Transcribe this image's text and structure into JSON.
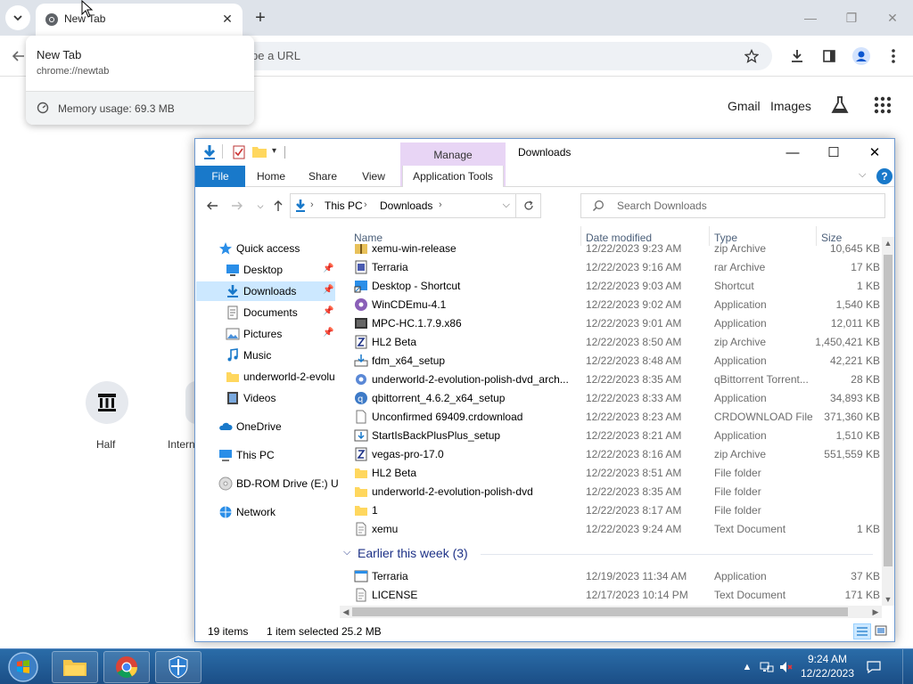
{
  "chrome": {
    "tab_title": "New Tab",
    "omnibox_text": "pe a URL",
    "ntp_links": [
      "Gmail",
      "Images"
    ],
    "shortcuts": [
      "Half",
      "Intern"
    ],
    "hover_card": {
      "title": "New Tab",
      "url": "chrome://newtab",
      "memory": "Memory usage: 69.3 MB"
    }
  },
  "explorer": {
    "title": "Downloads",
    "context_tab": "Manage",
    "ribbon_tabs": [
      "File",
      "Home",
      "Share",
      "View",
      "Application Tools"
    ],
    "breadcrumb": [
      "This PC",
      "Downloads"
    ],
    "search_placeholder": "Search Downloads",
    "nav": [
      {
        "label": "Quick access",
        "icon": "star-icon",
        "pinned": false
      },
      {
        "label": "Desktop",
        "icon": "desktop-icon",
        "pinned": true
      },
      {
        "label": "Downloads",
        "icon": "download-arrow-icon",
        "pinned": true,
        "selected": true
      },
      {
        "label": "Documents",
        "icon": "documents-icon",
        "pinned": true
      },
      {
        "label": "Pictures",
        "icon": "pictures-icon",
        "pinned": true
      },
      {
        "label": "Music",
        "icon": "music-note-icon",
        "pinned": false
      },
      {
        "label": "underworld-2-evolu",
        "icon": "folder-icon",
        "pinned": false
      },
      {
        "label": "Videos",
        "icon": "film-icon",
        "pinned": false
      },
      {
        "label": "OneDrive",
        "icon": "cloud-icon",
        "pinned": false
      },
      {
        "label": "This PC",
        "icon": "computer-icon",
        "pinned": false
      },
      {
        "label": "BD-ROM Drive (E:) UI",
        "icon": "disc-icon",
        "pinned": false
      },
      {
        "label": "Network",
        "icon": "network-icon",
        "pinned": false
      }
    ],
    "columns": [
      "Name",
      "Date modified",
      "Type",
      "Size"
    ],
    "files": [
      {
        "name": "xemu-win-release",
        "date": "12/22/2023 9:23 AM",
        "type": "zip Archive",
        "size": "10,645 KB",
        "icon": "zip-icon"
      },
      {
        "name": "Terraria",
        "date": "12/22/2023 9:16 AM",
        "type": "rar Archive",
        "size": "17 KB",
        "icon": "rar-icon"
      },
      {
        "name": "Desktop - Shortcut",
        "date": "12/22/2023 9:03 AM",
        "type": "Shortcut",
        "size": "1 KB",
        "icon": "shortcut-icon"
      },
      {
        "name": "WinCDEmu-4.1",
        "date": "12/22/2023 9:02 AM",
        "type": "Application",
        "size": "1,540 KB",
        "icon": "app-icon"
      },
      {
        "name": "MPC-HC.1.7.9.x86",
        "date": "12/22/2023 9:01 AM",
        "type": "Application",
        "size": "12,011 KB",
        "icon": "app-icon"
      },
      {
        "name": "HL2 Beta",
        "date": "12/22/2023 8:50 AM",
        "type": "zip Archive",
        "size": "1,450,421 KB",
        "icon": "zip-icon"
      },
      {
        "name": "fdm_x64_setup",
        "date": "12/22/2023 8:48 AM",
        "type": "Application",
        "size": "42,221 KB",
        "icon": "installer-icon"
      },
      {
        "name": "underworld-2-evolution-polish-dvd_arch...",
        "date": "12/22/2023 8:35 AM",
        "type": "qBittorrent Torrent...",
        "size": "28 KB",
        "icon": "torrent-icon"
      },
      {
        "name": "qbittorrent_4.6.2_x64_setup",
        "date": "12/22/2023 8:33 AM",
        "type": "Application",
        "size": "34,893 KB",
        "icon": "qbittorrent-icon"
      },
      {
        "name": "Unconfirmed 69409.crdownload",
        "date": "12/22/2023 8:23 AM",
        "type": "CRDOWNLOAD File",
        "size": "371,360 KB",
        "icon": "blank-file-icon"
      },
      {
        "name": "StartIsBackPlusPlus_setup",
        "date": "12/22/2023 8:21 AM",
        "type": "Application",
        "size": "1,510 KB",
        "icon": "installer-icon"
      },
      {
        "name": "vegas-pro-17.0",
        "date": "12/22/2023 8:16 AM",
        "type": "zip Archive",
        "size": "551,559 KB",
        "icon": "zip-icon"
      },
      {
        "name": "HL2 Beta",
        "date": "12/22/2023 8:51 AM",
        "type": "File folder",
        "size": "",
        "icon": "folder-icon"
      },
      {
        "name": "underworld-2-evolution-polish-dvd",
        "date": "12/22/2023 8:35 AM",
        "type": "File folder",
        "size": "",
        "icon": "folder-icon"
      },
      {
        "name": "1",
        "date": "12/22/2023 8:17 AM",
        "type": "File folder",
        "size": "",
        "icon": "folder-icon"
      },
      {
        "name": "xemu",
        "date": "12/22/2023 9:24 AM",
        "type": "Text Document",
        "size": "1 KB",
        "icon": "text-file-icon"
      }
    ],
    "group_label": "Earlier this week (3)",
    "files_earlier": [
      {
        "name": "Terraria",
        "date": "12/19/2023 11:34 AM",
        "type": "Application",
        "size": "37 KB",
        "icon": "app-icon"
      },
      {
        "name": "LICENSE",
        "date": "12/17/2023 10:14 PM",
        "type": "Text Document",
        "size": "171 KB",
        "icon": "text-file-icon"
      }
    ],
    "status": {
      "items": "19 items",
      "selected": "1 item selected",
      "size": "25.2 MB"
    }
  },
  "taskbar": {
    "time": "9:24 AM",
    "date": "12/22/2023"
  },
  "colors": {
    "chrome_tabbar": "#dee3ea",
    "ribbon_file": "#1979ca",
    "manage_tab": "#e8d5f5",
    "selected_nav": "#cce8ff",
    "taskbar": "#1b4e86",
    "group_header": "#1e3287"
  }
}
